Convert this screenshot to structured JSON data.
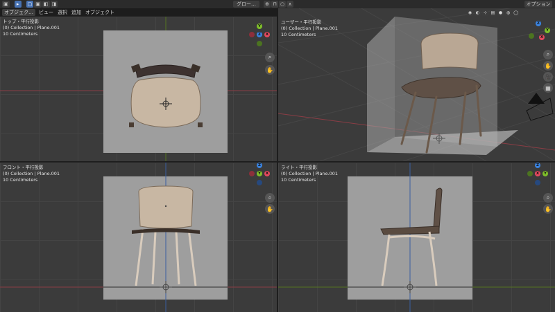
{
  "header": {
    "editor_icon": "▣",
    "tool_icons": [
      "▸",
      "▢",
      "▣",
      "◧",
      "◨"
    ],
    "transform_orientation": "グロー…",
    "snap_icon": "⊕",
    "proportional_icon": "○",
    "options_label": "オプション"
  },
  "menubar": {
    "mode_label": "オブジェク…",
    "items": [
      "ビュー",
      "選択",
      "追加",
      "オブジェクト"
    ]
  },
  "viewports": [
    {
      "title": "トップ・平行投影",
      "collection": "(0) Collection | Plane.001",
      "units": "10 Centimeters"
    },
    {
      "title": "ユーザー・平行投影",
      "collection": "(0) Collection | Plane.001",
      "units": "10 Centimeters"
    },
    {
      "title": "フロント・平行投影",
      "collection": "(0) Collection | Plane.001",
      "units": "10 Centimeters"
    },
    {
      "title": "ライト・平行投影",
      "collection": "(0) Collection | Plane.001",
      "units": "10 Centimeters"
    }
  ],
  "gizmo": {
    "x_label": "X",
    "y_label": "Y",
    "z_label": "Z"
  },
  "nav": {
    "zoom_icon": "⌕",
    "pan_icon": "✋",
    "camera_icon": "🎥",
    "grid_icon": "▦"
  },
  "colors": {
    "x_axis": "#e64a5f",
    "y_axis": "#7fbf2a",
    "z_axis": "#3a83e0",
    "reference_plane": "#9e9e9e",
    "chair_wood": "#b9a794"
  }
}
